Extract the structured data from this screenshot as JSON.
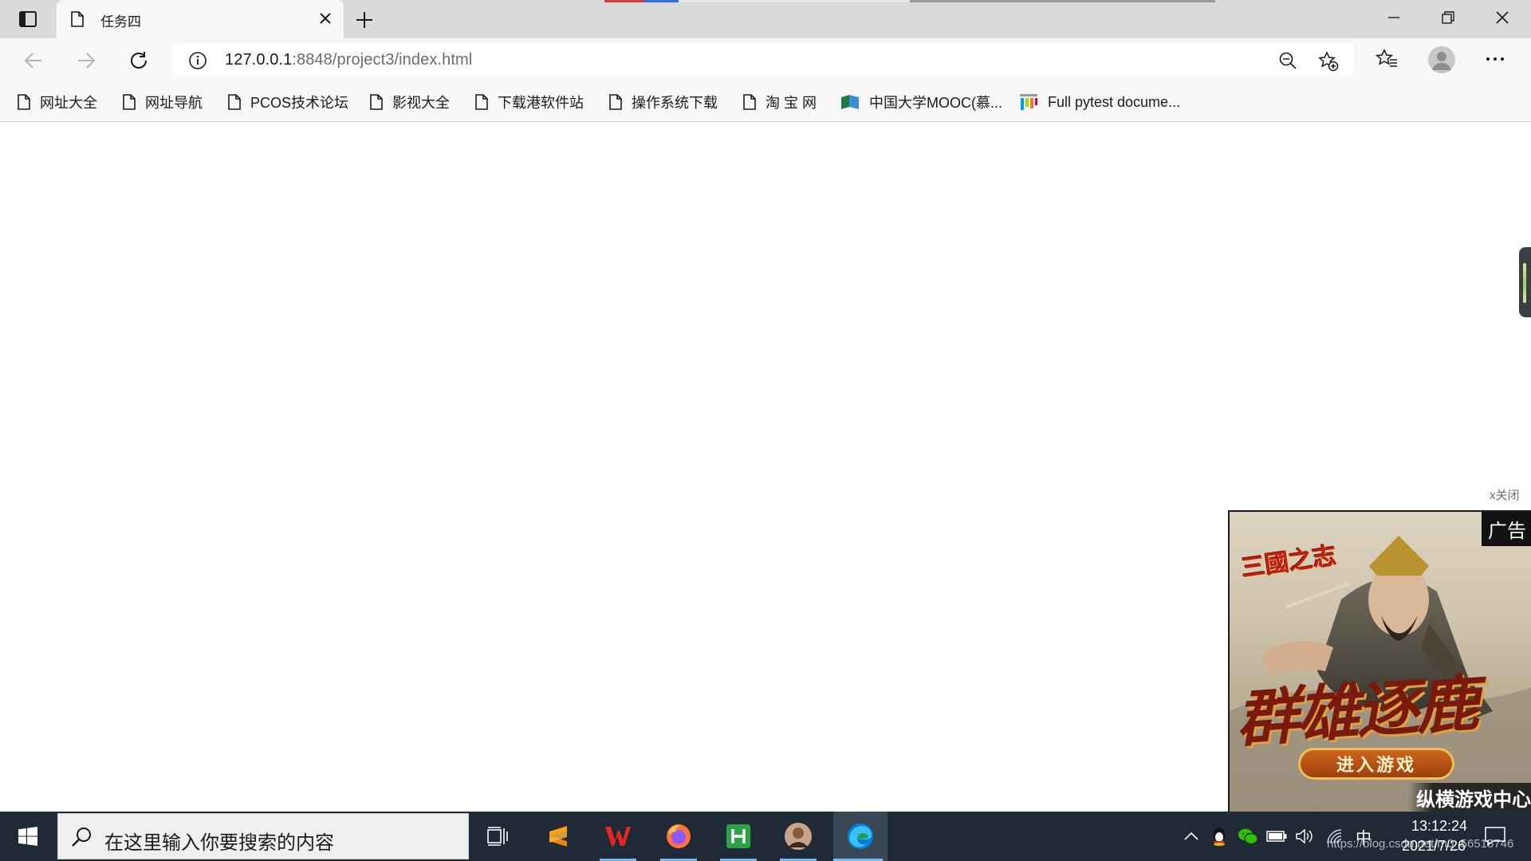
{
  "tab": {
    "title": "任务四"
  },
  "toolbar": {
    "url_host": "127.0.0.1",
    "url_rest": ":8848/project3/index.html"
  },
  "bookmarks": [
    {
      "label": "网址大全",
      "icon": "page-icon"
    },
    {
      "label": "网址导航",
      "icon": "page-icon"
    },
    {
      "label": "PCOS技术论坛",
      "icon": "page-icon"
    },
    {
      "label": "影视大全",
      "icon": "page-icon"
    },
    {
      "label": "下载港软件站",
      "icon": "page-icon"
    },
    {
      "label": "操作系统下载",
      "icon": "page-icon"
    },
    {
      "label": "淘 宝 网",
      "icon": "page-icon"
    },
    {
      "label": "中国大学MOOC(慕...",
      "icon": "mooc-icon"
    },
    {
      "label": "Full pytest docume...",
      "icon": "pytest-icon"
    }
  ],
  "ad": {
    "close_label": "x关闭",
    "badge": "广告",
    "game_title": "三國之志",
    "slogan": "群雄逐鹿",
    "cta": "进入游戏",
    "footer": "纵横游戏中心"
  },
  "taskbar": {
    "search_placeholder": "在这里输入你要搜索的内容",
    "apps": [
      "task-view",
      "sublime-text",
      "wps-office",
      "firefox",
      "hbuilder",
      "user-photo-app",
      "microsoft-edge"
    ],
    "ime": "中",
    "time": "13:12:24",
    "date": "2021/7/26",
    "watermark": "https://blog.csdn.net/m0_56515746"
  },
  "colors": {
    "taskbar": "#1f2a36",
    "tabstrip": "#dadada",
    "toolbar": "#f7f7f7",
    "accent": "#76b9ed"
  }
}
